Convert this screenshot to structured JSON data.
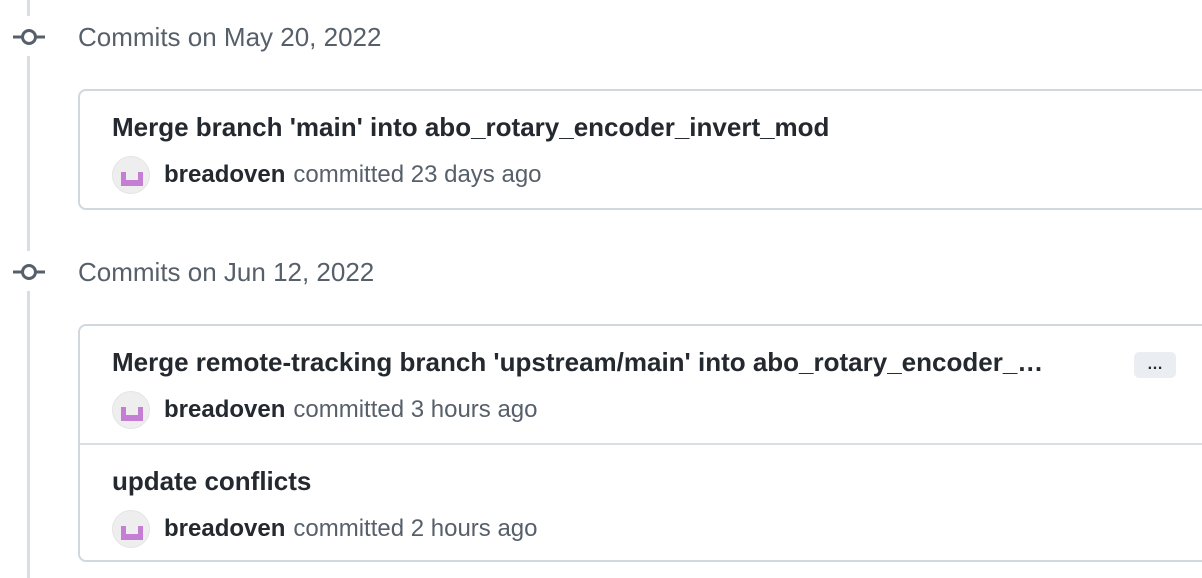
{
  "groups": [
    {
      "title": "Commits on May 20, 2022",
      "commits": [
        {
          "message": "Merge branch 'main' into abo_rotary_encoder_invert_mod",
          "author": "breadoven",
          "committed": "committed 23 days ago",
          "has_ellipsis": false
        }
      ]
    },
    {
      "title": "Commits on Jun 12, 2022",
      "commits": [
        {
          "message": "Merge remote-tracking branch 'upstream/main' into abo_rotary_encoder_…",
          "author": "breadoven",
          "committed": "committed 3 hours ago",
          "has_ellipsis": true,
          "ellipsis_label": "…"
        },
        {
          "message": "update conflicts",
          "author": "breadoven",
          "committed": "committed 2 hours ago",
          "has_ellipsis": false
        }
      ]
    }
  ],
  "icons": {
    "timeline_node": "git-commit-icon",
    "avatar": "identicon-avatar"
  },
  "colors": {
    "avatar_glyph": "#c47fd5",
    "timeline": "#d8dee4",
    "muted_text": "#57606a"
  }
}
